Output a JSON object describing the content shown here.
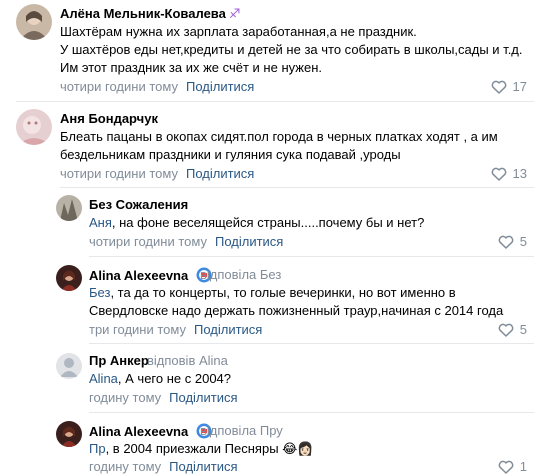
{
  "comments": [
    {
      "name": "Алёна Мельник-Ковалева",
      "name_emoji": "♐",
      "lines": [
        "Шахтёрам нужна их зарплата заработанная,а не праздник.",
        "У шахтёров еды нет,кредиты и детей не за что собирать в школы,сады и т.д.",
        "Им этот праздник за их же счёт и не нужен."
      ],
      "time": "чотири години тому",
      "share": "Поділитися",
      "likes": "17"
    },
    {
      "name": "Аня Бондарчук",
      "lines": [
        "Блеать пацаны в окопах сидят.пол города в черных платках ходят , а им",
        "бездельникам праздники и гуляния сука подавай ,уроды"
      ],
      "time": "чотири години тому",
      "share": "Поділитися",
      "likes": "13"
    }
  ],
  "replies": [
    {
      "name": "Без Сожаления",
      "mention": "Аня",
      "lines": [
        ", на фоне веселящейся страны.....почему бы и нет?"
      ],
      "time": "чотири години тому",
      "share": "Поділитися",
      "likes": "5"
    },
    {
      "name": "Alina Alexeevna",
      "replied_to": "відповіла Без",
      "mention": "Без",
      "lines": [
        ", та да то концерты, то голые вечеринки, но вот именно в",
        "Свердловске надо держать пожизненный траур,начиная с 2014 года"
      ],
      "time": "три години тому",
      "share": "Поділитися",
      "likes": "5"
    },
    {
      "name": "Пр Анкер",
      "replied_to": "відповів Alina",
      "mention": "Alina",
      "lines": [
        ", А чего не с 2004?"
      ],
      "time": "годину тому",
      "share": "Поділитися"
    },
    {
      "name": "Alina Alexeevna",
      "replied_to": "відповіла Пру",
      "mention": "Пр",
      "lines": [
        ", в 2004 приезжали Песняры 😂👩🏻"
      ],
      "time": "годину тому",
      "share": "Поділитися",
      "likes": "1"
    }
  ],
  "colors": {
    "link": "#2a5885",
    "meta": "#818c99",
    "divider": "#e7e8ec"
  }
}
